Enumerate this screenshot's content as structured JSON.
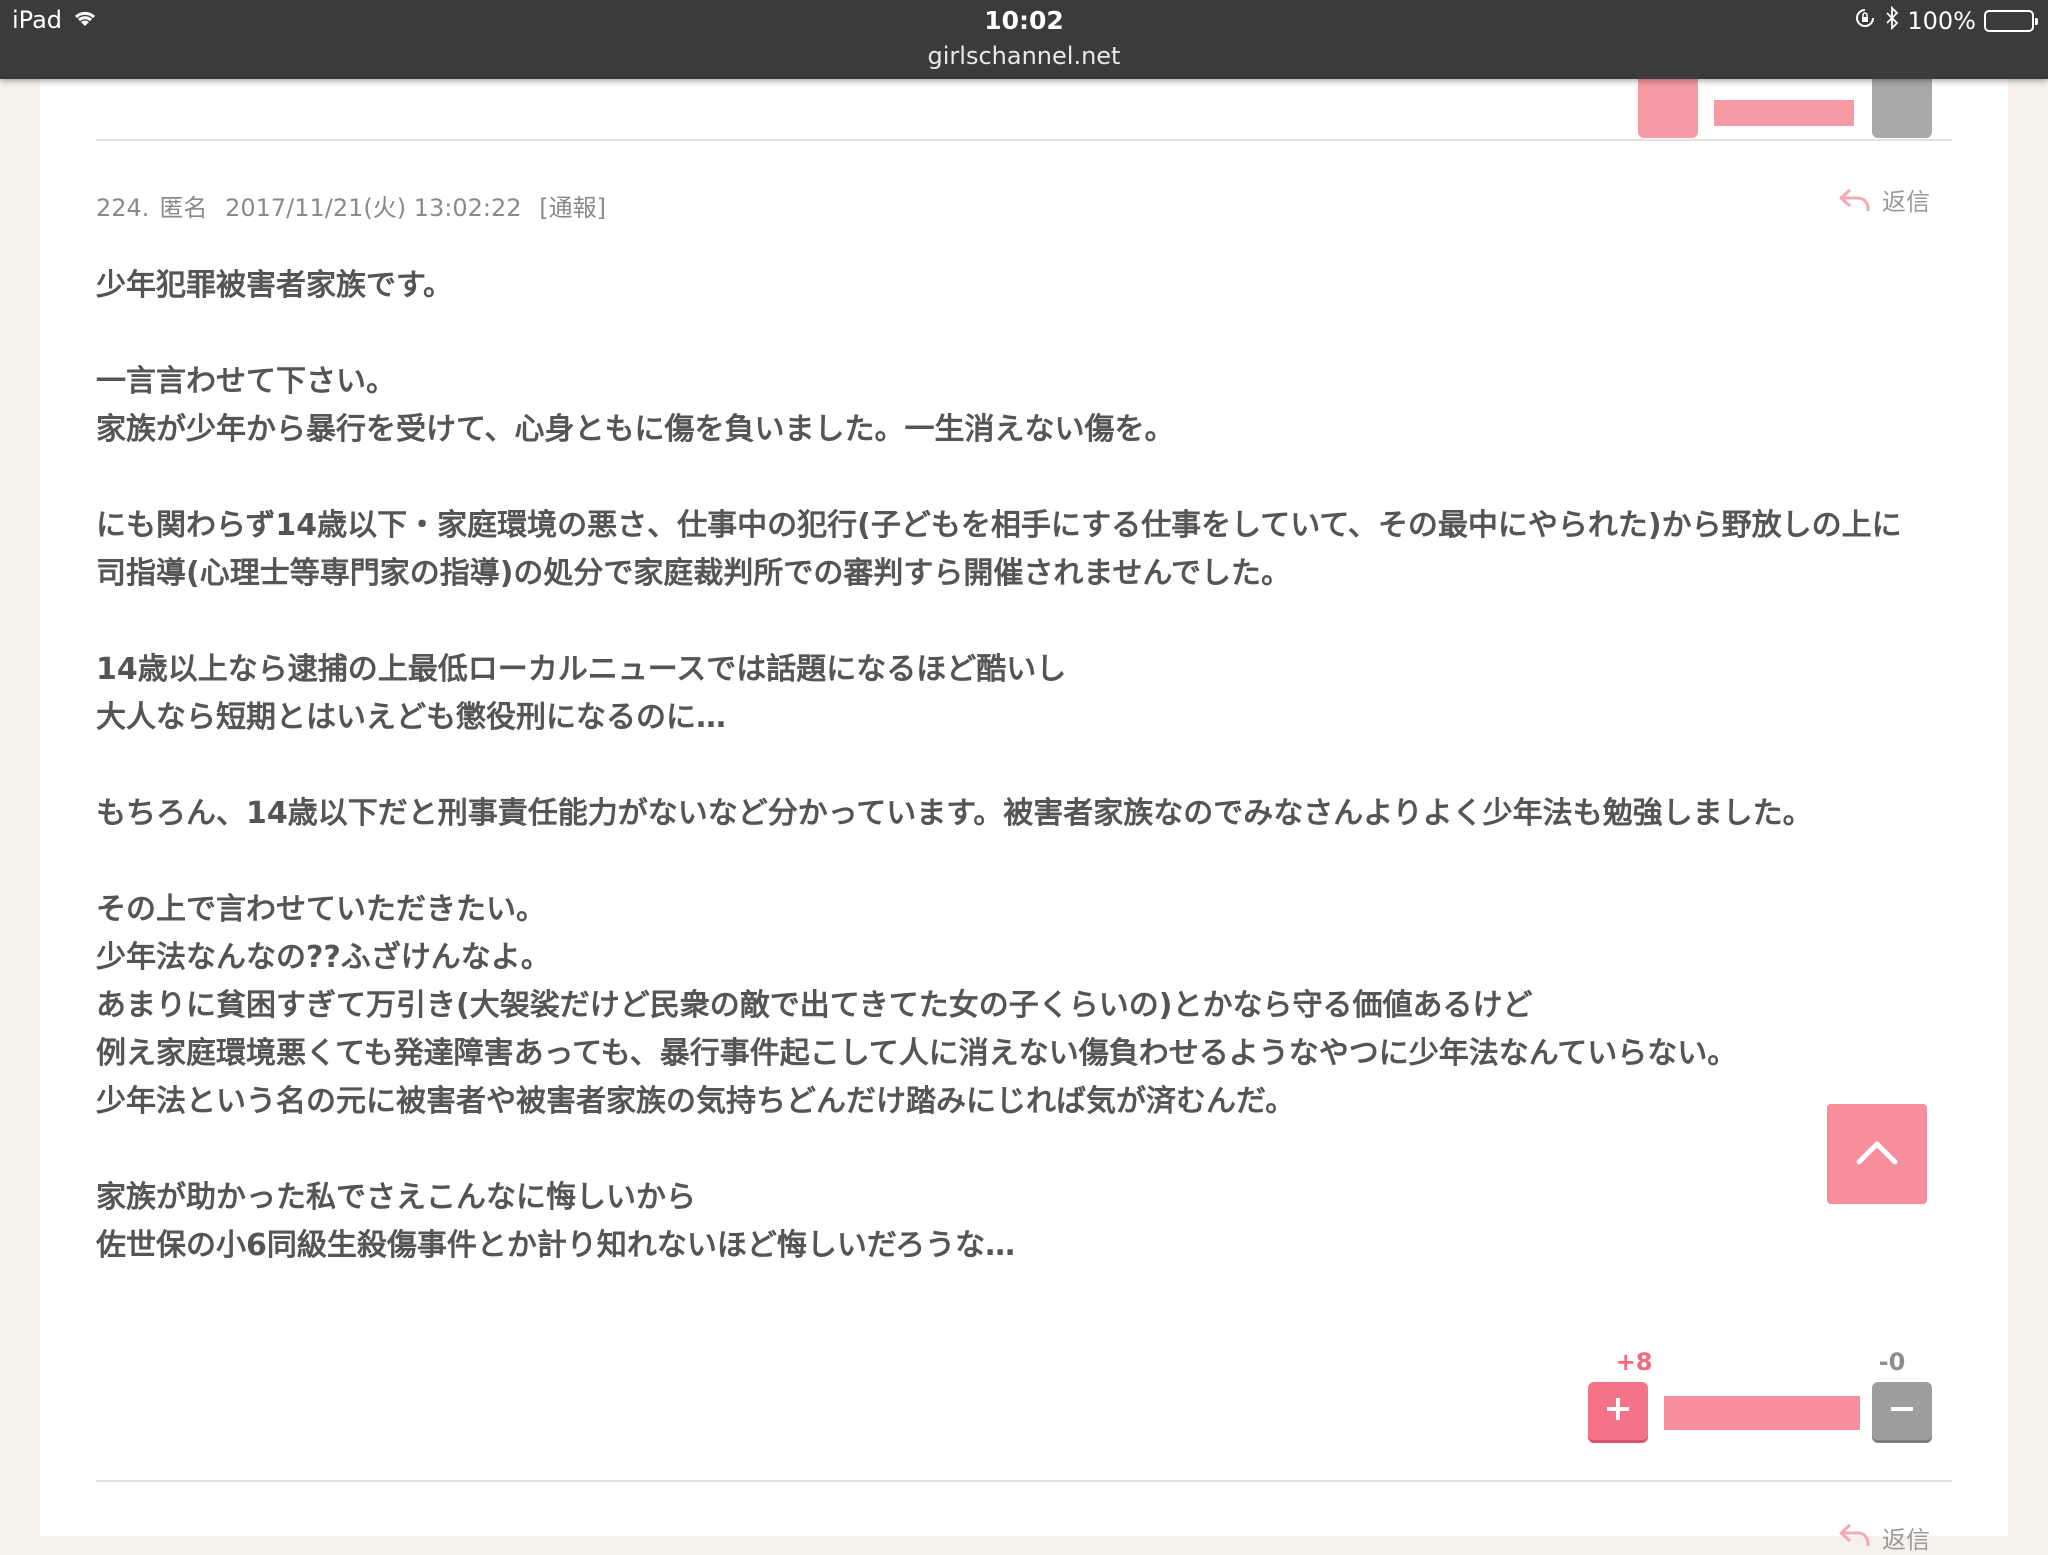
{
  "status_bar": {
    "device": "iPad",
    "time": "10:02",
    "url": "girlschannel.net",
    "battery": "100%"
  },
  "comment": {
    "number": "224.",
    "author": "匿名",
    "datetime": "2017/11/21(火) 13:02:22",
    "report": "[通報]",
    "reply_label": "返信",
    "paragraphs": [
      [
        "少年犯罪被害者家族です。"
      ],
      [
        "一言言わせて下さい。",
        "家族が少年から暴行を受けて、心身ともに傷を負いました。一生消えない傷を。"
      ],
      [
        "にも関わらず14歳以下・家庭環境の悪さ、仕事中の犯行(子どもを相手にする仕事をしていて、その最中にやられた)から野放しの上に",
        "司指導(心理士等専門家の指導)の処分で家庭裁判所での審判すら開催されませんでした。"
      ],
      [
        "14歳以上なら逮捕の上最低ローカルニュースでは話題になるほど酷いし",
        "大人なら短期とはいえども懲役刑になるのに…"
      ],
      [
        "もちろん、14歳以下だと刑事責任能力がないなど分かっています。被害者家族なのでみなさんよりよく少年法も勉強しました。"
      ],
      [
        "その上で言わせていただきたい。",
        "少年法なんなの??ふざけんなよ。",
        "あまりに貧困すぎて万引き(大袈裟だけど民衆の敵で出てきてた女の子くらいの)とかなら守る価値あるけど",
        "例え家庭環境悪くても発達障害あっても、暴行事件起こして人に消えない傷負わせるようなやつに少年法なんていらない。",
        "少年法という名の元に被害者や被害者家族の気持ちどんだけ踏みにじれば気が済むんだ。"
      ],
      [
        "家族が助かった私でさえこんなに悔しいから",
        "佐世保の小6同級生殺傷事件とか計り知れないほど悔しいだろうな…"
      ]
    ],
    "votes": {
      "plus": "+8",
      "minus": "-0",
      "plus_ratio": 1.0
    }
  },
  "next_comment": {
    "reply_label": "返信"
  },
  "colors": {
    "accent_pink": "#f57388",
    "neutral_gray": "#9e9e9e",
    "page_bg": "#f6f1ea"
  }
}
